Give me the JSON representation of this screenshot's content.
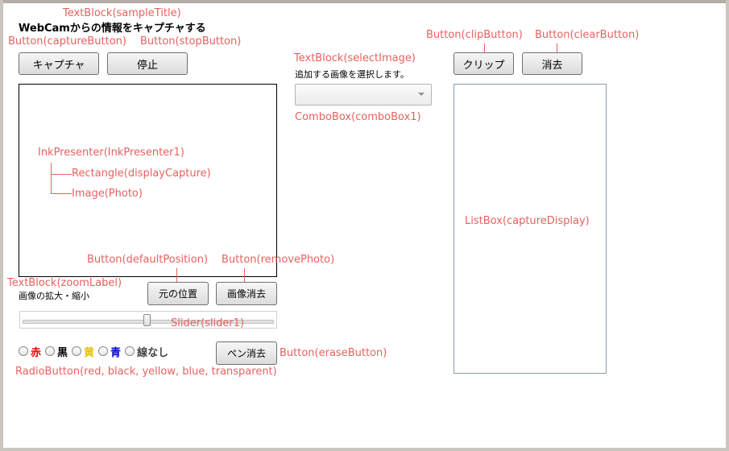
{
  "header": {
    "title": "WebCamからの情報をキャプチャする"
  },
  "buttons": {
    "capture": "キャプチャ",
    "stop": "停止",
    "clip": "クリップ",
    "clear": "消去",
    "default_position": "元の位置",
    "remove_photo": "画像消去",
    "erase": "ペン消去"
  },
  "labels": {
    "select_image": "追加する画像を選択します。",
    "zoom": "画像の拡大・縮小"
  },
  "radios": [
    {
      "label": "赤",
      "color": "#e00000"
    },
    {
      "label": "黒",
      "color": "#000000"
    },
    {
      "label": "黄",
      "color": "#e8c000"
    },
    {
      "label": "青",
      "color": "#0000d0"
    },
    {
      "label": "線なし",
      "color": "#444444"
    }
  ],
  "annotations": {
    "sample_title": "TextBlock(sampleTitle)",
    "capture_button": "Button(captureButton)",
    "stop_button": "Button(stopButton)",
    "select_image": "TextBlock(selectImage)",
    "combo_box": "ComboBox(comboBox1)",
    "clip_button": "Button(clipButton)",
    "clear_button": "Button(clearButton)",
    "ink_presenter": "InkPresenter(InkPresenter1)",
    "rectangle": "Rectangle(displayCapture)",
    "image": "Image(Photo)",
    "list_box": "ListBox(captureDisplay)",
    "default_position": "Button(defaultPosition)",
    "remove_photo": "Button(removePhoto)",
    "zoom_label": "TextBlock(zoomLabel)",
    "slider": "Slider(slider1)",
    "erase_button": "Button(eraseButton)",
    "radio_buttons": "RadioButton(red, black, yellow, blue, transparent)"
  },
  "colors": {
    "annotation": "#e8615e",
    "frame": "#c9c5bf"
  }
}
